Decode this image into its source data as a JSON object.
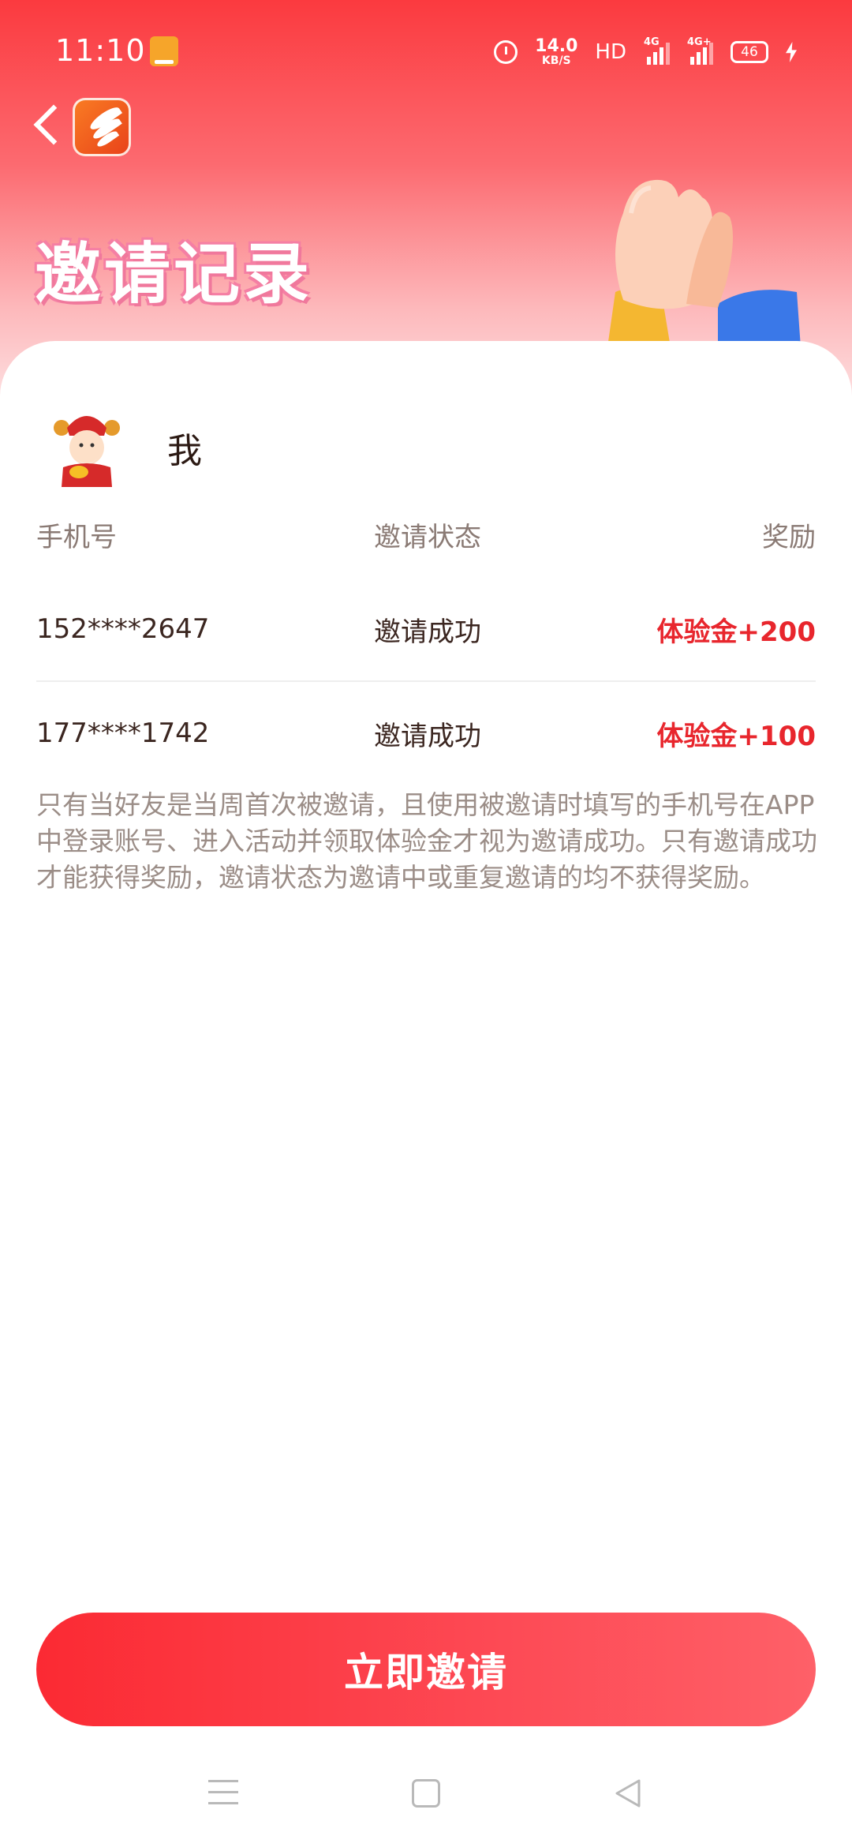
{
  "status_bar": {
    "time": "11:10",
    "net_speed_value": "14.0",
    "net_speed_unit": "KB/S",
    "hd": "HD",
    "sig1_label": "4G",
    "sig2_label": "4G+",
    "battery": "46"
  },
  "header": {
    "title": "邀请记录"
  },
  "card": {
    "me_label": "我",
    "columns": [
      "手机号",
      "邀请状态",
      "奖励"
    ],
    "rows": [
      {
        "phone": "152****2647",
        "status": "邀请成功",
        "reward": "体验金+200"
      },
      {
        "phone": "177****1742",
        "status": "邀请成功",
        "reward": "体验金+100"
      }
    ],
    "note": "只有当好友是当周首次被邀请，且使用被邀请时填写的手机号在APP中登录账号、进入活动并领取体验金才视为邀请成功。只有邀请成功才能获得奖励，邀请状态为邀请中或重复邀请的均不获得奖励。"
  },
  "invite_button_label": "立即邀请",
  "colors": {
    "brand_red": "#fb2a33",
    "reward_red": "#e8262d"
  },
  "icons": [
    "back-icon",
    "app-logo-icon",
    "alarm-icon",
    "signal-icon",
    "battery-icon",
    "hands-illustration",
    "avatar-icon",
    "menu-icon",
    "home-icon",
    "nav-back-icon"
  ]
}
